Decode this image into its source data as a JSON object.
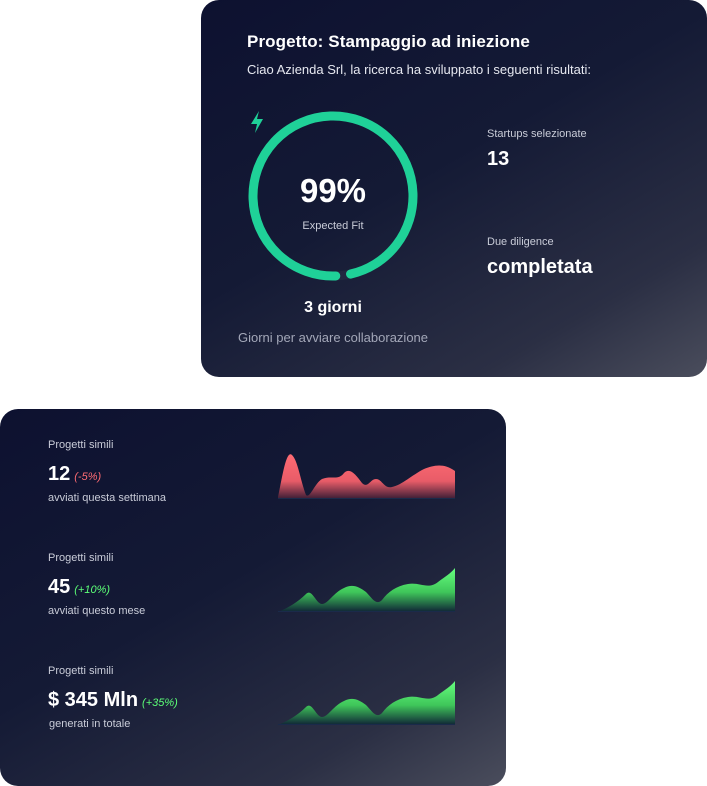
{
  "project": {
    "title": "Progetto: Stampaggio ad iniezione",
    "subtitle": "Ciao Azienda Srl, la ricerca ha sviluppato i seguenti risultati:"
  },
  "fit": {
    "value": "99%",
    "fraction": 0.99,
    "label": "Expected Fit",
    "icon": "lightning-bolt-icon",
    "color": "#1fd198"
  },
  "timing": {
    "value": "3 giorni",
    "label": "Giorni per avviare collaborazione"
  },
  "stats": {
    "startups_label": "Startups selezionate",
    "startups_value": "13",
    "dd_label": "Due diligence",
    "dd_value": "completata"
  },
  "similar": [
    {
      "label": "Progetti simili",
      "value": "12",
      "change": "(-5%)",
      "trend": "negative",
      "desc": "avviati questa settimana",
      "color": "#ff6b73"
    },
    {
      "label": "Progetti simili",
      "value": "45",
      "change": "(+10%)",
      "trend": "positive",
      "desc": "avviati questo mese",
      "color": "#5cff77"
    },
    {
      "label": "Progetti simili",
      "value": "$ 345 Mln",
      "change": "(+35%)",
      "trend": "positive",
      "desc": "generati in totale",
      "color": "#5cff77"
    }
  ]
}
